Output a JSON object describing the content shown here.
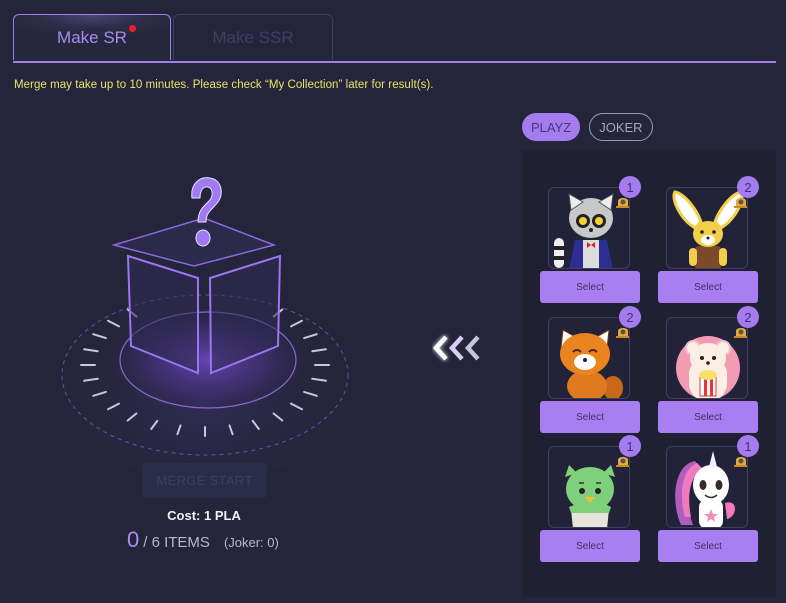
{
  "tabs": [
    {
      "label": "Make SR",
      "active": true,
      "has_notification": true
    },
    {
      "label": "Make SSR",
      "active": false,
      "has_notification": false
    }
  ],
  "notice": "Merge may take up to 10 minutes. Please check “My Collection” later for result(s).",
  "merge": {
    "button_label": "MERGE START",
    "button_enabled": false,
    "cost": "Cost: 1 PLA",
    "selected_count": "0",
    "total_label": "/ 6 ITEMS",
    "joker_label": "(Joker: 0)"
  },
  "filters": [
    {
      "label": "PLAYZ",
      "active": true
    },
    {
      "label": "JOKER",
      "active": false
    }
  ],
  "cards": [
    {
      "character": "lemur",
      "count": "1",
      "select_label": "Select"
    },
    {
      "character": "fennec-fox",
      "count": "2",
      "select_label": "Select"
    },
    {
      "character": "red-panda",
      "count": "2",
      "select_label": "Select"
    },
    {
      "character": "hedgehog",
      "count": "2",
      "select_label": "Select"
    },
    {
      "character": "green-chick",
      "count": "1",
      "select_label": "Select"
    },
    {
      "character": "unicorn",
      "count": "1",
      "select_label": "Select"
    }
  ],
  "colors": {
    "accent": "#a57cf0",
    "background": "#24253a",
    "notice": "#e9e46a",
    "notification_dot": "#ee1d28"
  }
}
